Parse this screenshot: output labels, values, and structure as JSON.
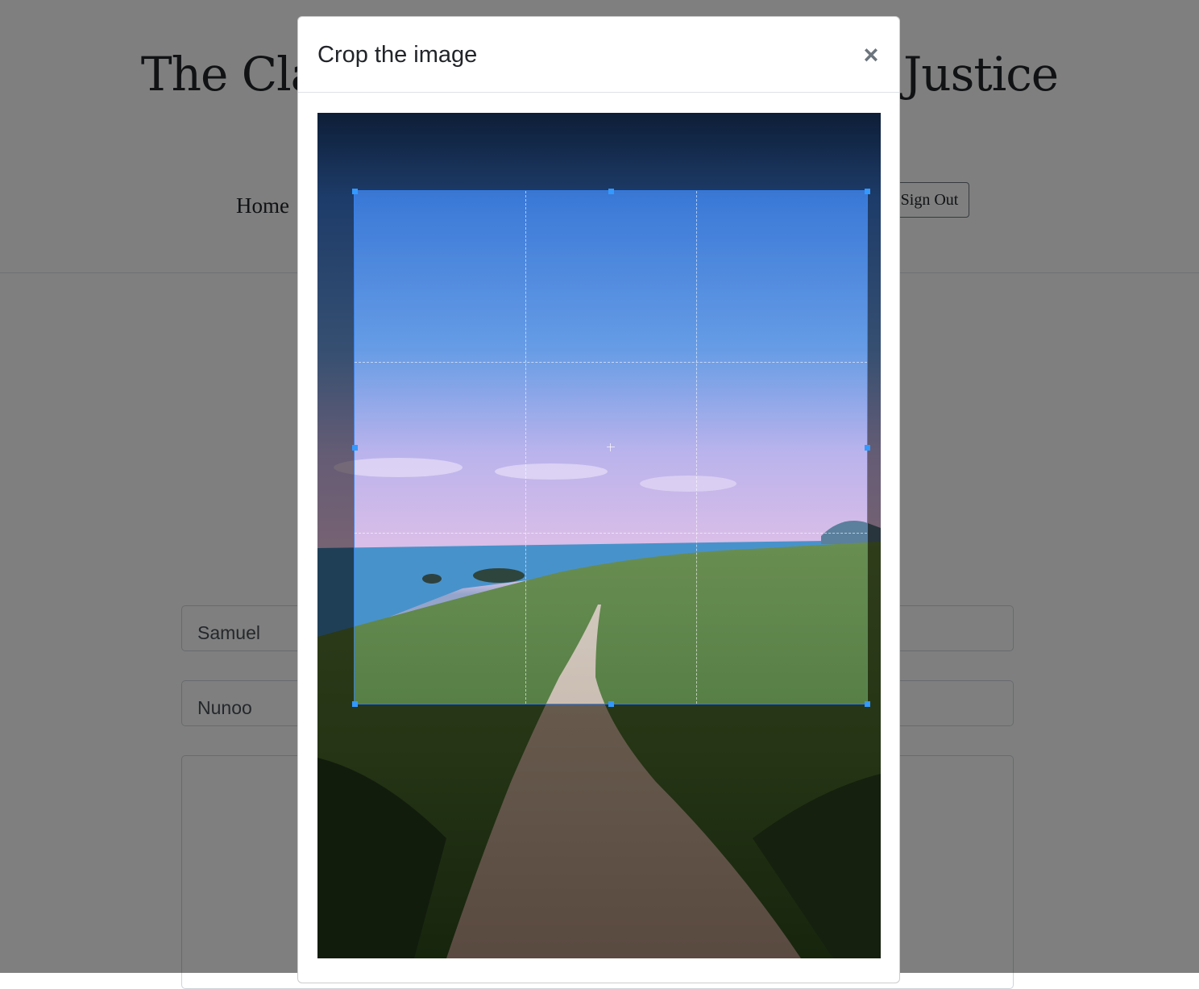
{
  "site": {
    "title": "The Clarendon Center for Racial Justice",
    "nav_home": "Home",
    "sign_out": "Sign Out"
  },
  "form": {
    "first_name": "Samuel",
    "last_name": "Nunoo",
    "bio": ""
  },
  "modal": {
    "title": "Crop the image",
    "close_label": "×"
  },
  "cropper": {
    "image_subject": "coastal dirt trail under pink-blue sky",
    "colors": {
      "sky_top": "#1b3c6e",
      "sky_mid": "#6c9fe3",
      "sky_horizon": "#e9c3e6",
      "sea": "#3f7fae",
      "shrub": "#4e6c2f",
      "trail": "#b89985",
      "accent": "#3399ff"
    }
  }
}
